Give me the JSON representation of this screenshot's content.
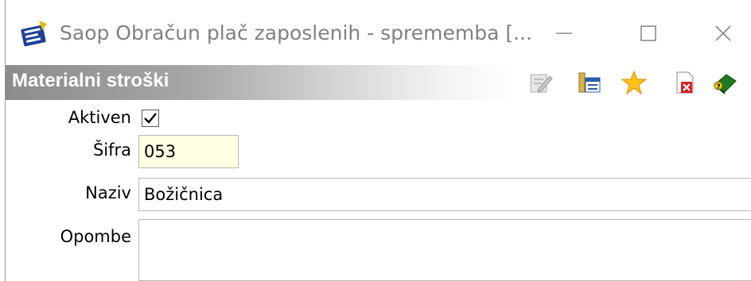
{
  "window": {
    "title": "Saop Obračun plač zaposlenih - sprememba [..."
  },
  "header": {
    "title": "Materialni stroški",
    "toolbar_icons": [
      "edit-icon",
      "list-icon",
      "star-icon",
      "delete-icon",
      "book-icon"
    ]
  },
  "form": {
    "aktiven_label": "Aktiven",
    "aktiven_checked": true,
    "sifra_label": "Šifra",
    "sifra_value": "053",
    "naziv_label": "Naziv",
    "naziv_value": "Božičnica",
    "opombe_label": "Opombe",
    "opombe_value": ""
  },
  "colors": {
    "code_field_bg": "#ffffe1",
    "header_gradient_start": "#8c8c8c"
  }
}
